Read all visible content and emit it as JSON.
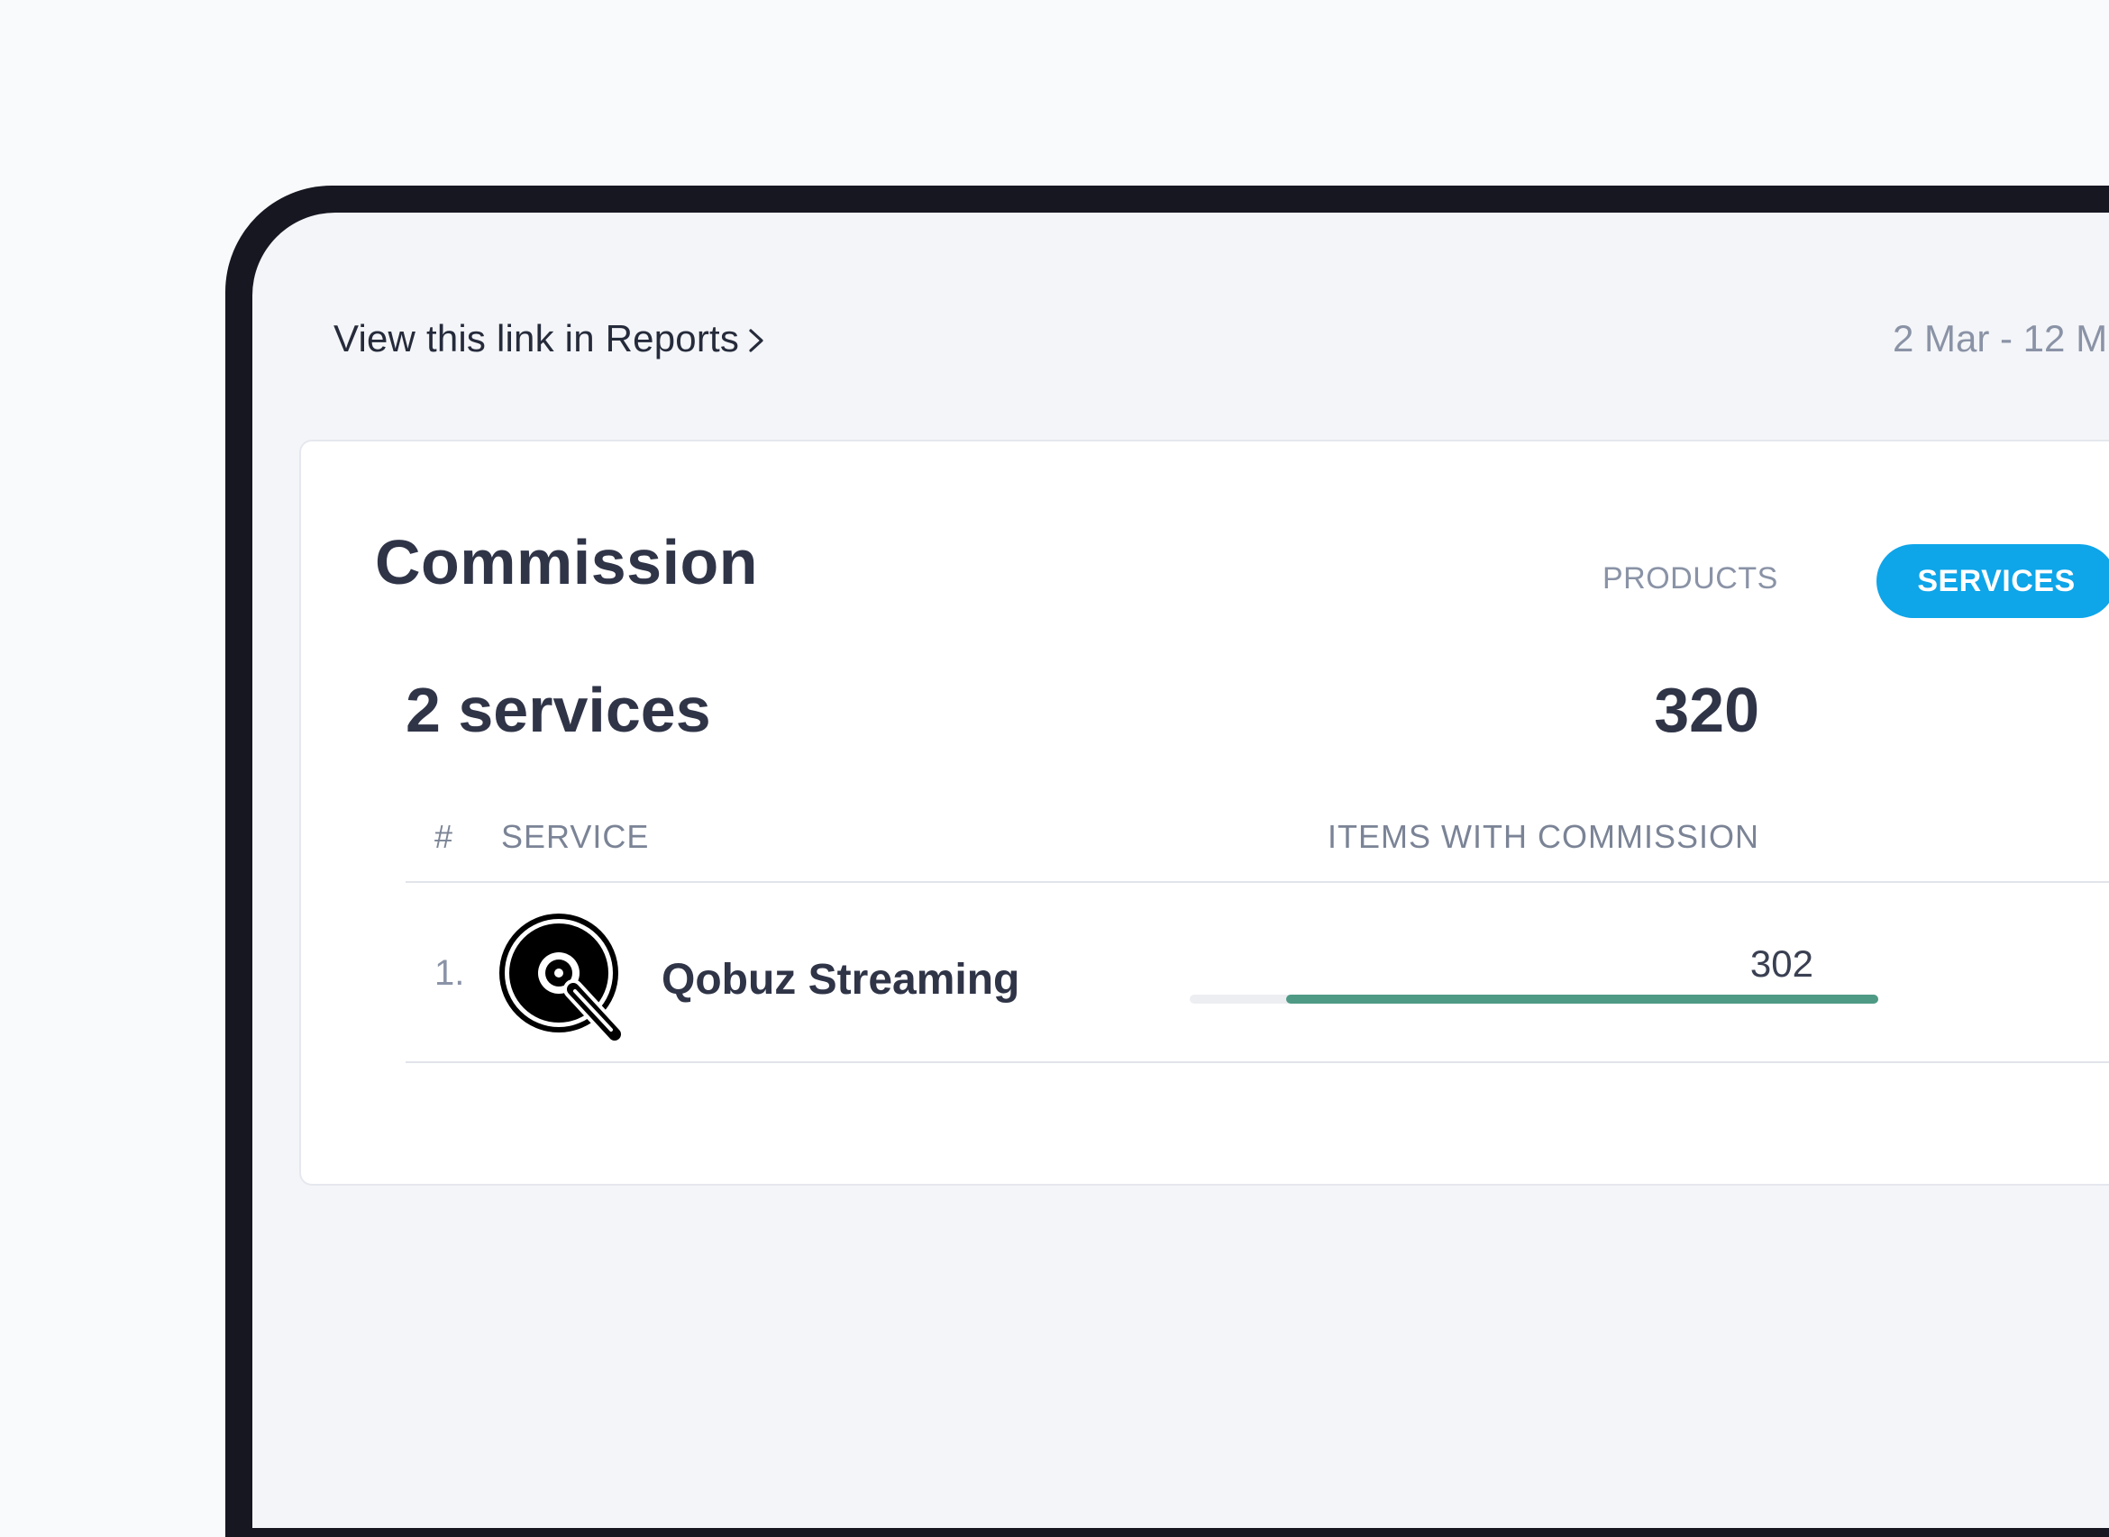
{
  "header": {
    "reports_link": "View this link in Reports",
    "date_range": "2 Mar - 12 M"
  },
  "card": {
    "title": "Commission",
    "toggle": {
      "products_label": "PRODUCTS",
      "services_label": "SERVICES",
      "active": "SERVICES"
    },
    "summary": {
      "count_label": "2 services",
      "total": "320"
    },
    "table": {
      "columns": {
        "rank": "#",
        "service": "SERVICE",
        "items": "ITEMS WITH COMMISSION"
      },
      "rows": [
        {
          "rank": "1.",
          "service": "Qobuz Streaming",
          "logo_icon": "qobuz-logo",
          "items": "302",
          "share": 0.86
        }
      ]
    }
  },
  "colors": {
    "accent": "#0ea5e9",
    "bar": "#4f9a85",
    "bar_track": "#eceef2",
    "frame": "#171722"
  }
}
